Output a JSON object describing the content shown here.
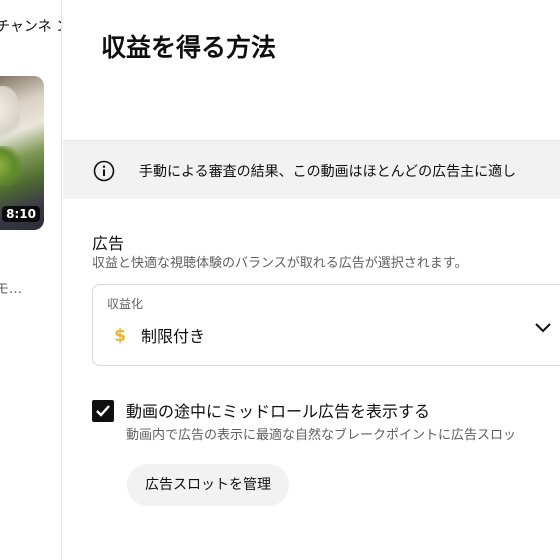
{
  "sidebar": {
    "top_text": "チャンネ  ン",
    "thumbnail_duration": "8:10",
    "caption": "モ…"
  },
  "main": {
    "title": "収益を得る方法",
    "banner": {
      "icon": "info-icon",
      "text": "手動による審査の結果、この動画はほとんどの広告主に適し"
    },
    "ads": {
      "heading": "広告",
      "description": "収益と快適な視聴体験のバランスが取れる広告が選択されます。",
      "monetization_select": {
        "label": "収益化",
        "icon": "dollar-icon",
        "value": "制限付き",
        "value_icon_color": "#f1b32b"
      },
      "midroll_checkbox": {
        "checked": true,
        "label": "動画の途中にミッドロール広告を表示する",
        "description": "動画内で広告の表示に最適な自然なブレークポイントに広告スロッ"
      },
      "manage_button": "広告スロットを管理"
    }
  }
}
